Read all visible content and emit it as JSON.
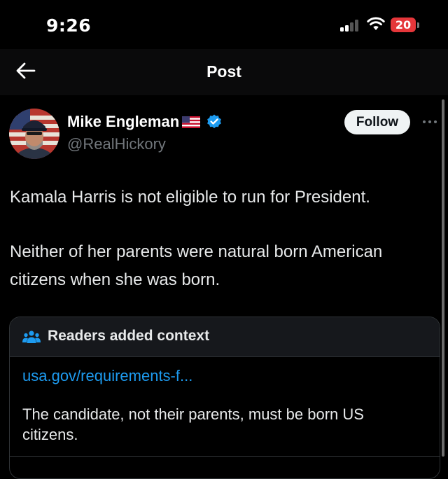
{
  "status_bar": {
    "time": "9:26",
    "battery": "20",
    "icons": [
      "signal-icon",
      "wifi-icon",
      "battery-icon"
    ],
    "battery_color": "#e5363a"
  },
  "header": {
    "title": "Post",
    "back_icon": "back-arrow-icon"
  },
  "post": {
    "author": {
      "name": "Mike Engleman",
      "handle": "@RealHickory",
      "badges": [
        "us-flag-icon",
        "verified-badge-icon"
      ]
    },
    "follow_label": "Follow",
    "more_icon": "more-dots-icon",
    "text": [
      "Kamala Harris is not eligible to run for President.",
      "Neither of her parents were natural born American citizens when she was born."
    ]
  },
  "context_note": {
    "title": "Readers added context",
    "icon": "people-icon",
    "link": "usa.gov/requirements-f...",
    "text": "The candidate, not their parents, must be born US citizens."
  },
  "colors": {
    "background": "#000000",
    "text": "#e7e9ea",
    "secondary_text": "#71767b",
    "link": "#1d9bf0",
    "verified": "#1d9bf0",
    "follow_bg": "#eff3f4"
  }
}
